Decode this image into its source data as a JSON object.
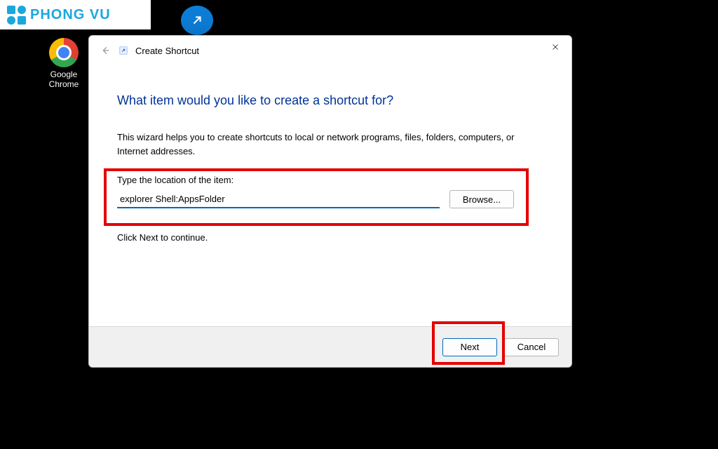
{
  "watermark": {
    "text": "PHONG VU"
  },
  "desktop": {
    "chrome_label": "Google Chrome"
  },
  "dialog": {
    "title": "Create Shortcut",
    "heading": "What item would you like to create a shortcut for?",
    "wizard_text": "This wizard helps you to create shortcuts to local or network programs, files, folders, computers, or Internet addresses.",
    "location_label": "Type the location of the item:",
    "location_value": "explorer Shell:AppsFolder",
    "browse_label": "Browse...",
    "continue_text": "Click Next to continue.",
    "next_label": "Next",
    "cancel_label": "Cancel"
  }
}
